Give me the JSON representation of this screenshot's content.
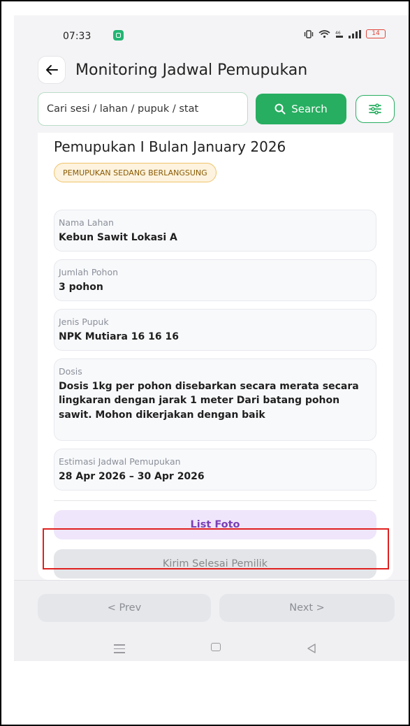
{
  "status_bar": {
    "time": "07:33",
    "battery": "14"
  },
  "header": {
    "title": "Monitoring Jadwal Pemupukan"
  },
  "search": {
    "value": "Cari sesi / lahan / pupuk / stat",
    "button_label": "Search"
  },
  "card": {
    "title": "Pemupukan I Bulan January 2026",
    "status_badge": "PEMUPUKAN SEDANG BERLANGSUNG",
    "fields": [
      {
        "label": "Nama Lahan",
        "value": "Kebun Sawit Lokasi A"
      },
      {
        "label": "Jumlah Pohon",
        "value": "3 pohon"
      },
      {
        "label": "Jenis Pupuk",
        "value": "NPK Mutiara 16 16 16"
      },
      {
        "label": "Dosis",
        "value": "Dosis 1kg per pohon disebarkan secara merata secara lingkaran dengan jarak 1 meter Dari batang pohon sawit. Mohon dikerjakan dengan baik"
      },
      {
        "label": "Estimasi Jadwal Pemupukan",
        "value": "28 Apr 2026 – 30 Apr 2026"
      }
    ],
    "list_foto_label": "List Foto",
    "kirim_label": "Kirim Selesai Pemilik"
  },
  "pagination": {
    "prev_label": "< Prev",
    "next_label": "Next >"
  },
  "colors": {
    "accent": "#27ae60",
    "badge_bg": "#fdf3df",
    "highlight": "#e02020"
  },
  "icons": [
    "back-arrow-icon",
    "search-icon",
    "filter-icon",
    "menu-icon",
    "home-icon",
    "back-nav-icon"
  ]
}
